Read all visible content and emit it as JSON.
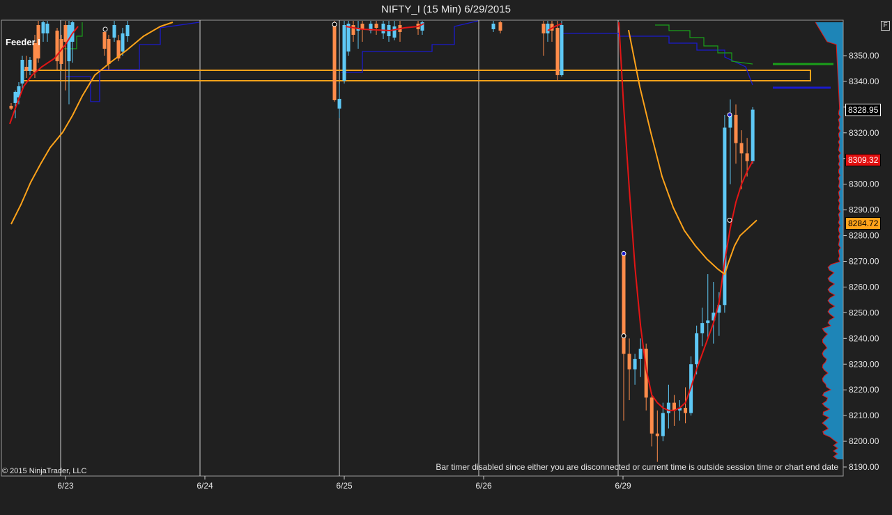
{
  "title": "NIFTY_I (15 Min)  6/29/2015",
  "feeder_label": "Feeder I",
  "copyright": "© 2015 NinjaTrader, LLC",
  "bar_timer_message": "Bar timer disabled since either you are disconnected or current time is outside session time or chart end date",
  "f_button": "F",
  "price_tags": {
    "last": "8328.95",
    "red_ma": "8309.32",
    "orange_ma": "8284.72"
  },
  "colors": {
    "background": "#202020",
    "up_candle": "#5ec8f5",
    "down_candle": "#ff8c4a",
    "fast_ma": "#e31515",
    "slow_ma": "#ffa31a",
    "zone": "#ffa31a",
    "blue_line": "#1a1acc",
    "green_line": "#1aa01a",
    "volume_profile": "#1e90c8",
    "profile_edge": "#e31515"
  },
  "chart_data": {
    "type": "candlestick",
    "title": "NIFTY_I (15 Min)  6/29/2015",
    "y_ticks": [
      8190,
      8200,
      8210,
      8220,
      8230,
      8240,
      8250,
      8260,
      8270,
      8280,
      8290,
      8300,
      8310,
      8320,
      8330,
      8340,
      8350
    ],
    "y_tick_labels": [
      "8190.00",
      "8200.00",
      "8210.00",
      "8220.00",
      "8230.00",
      "8240.00",
      "8250.00",
      "8260.00",
      "8270.00",
      "8280.00",
      "8290.00",
      "8300.00",
      "8310.00",
      "8320.00",
      "8330.00",
      "8340.00",
      "8350.00"
    ],
    "ylim": [
      8185,
      8358
    ],
    "x_labels": [
      "6/23",
      "6/24",
      "6/25",
      "6/26",
      "6/29"
    ],
    "session_boundaries": [
      "6/23",
      "6/24",
      "6/25",
      "6/26",
      "6/29"
    ],
    "resistance_zone": [
      8340.5,
      8342.5
    ],
    "candles_6_29": [
      {
        "o": 8273,
        "h": 8274,
        "l": 8208,
        "c": 8234
      },
      {
        "o": 8234,
        "h": 8240,
        "l": 8216,
        "c": 8228
      },
      {
        "o": 8228,
        "h": 8234,
        "l": 8222,
        "c": 8232
      },
      {
        "o": 8232,
        "h": 8240,
        "l": 8225,
        "c": 8236
      },
      {
        "o": 8236,
        "h": 8238,
        "l": 8212,
        "c": 8217
      },
      {
        "o": 8217,
        "h": 8219,
        "l": 8198,
        "c": 8203
      },
      {
        "o": 8203,
        "h": 8212,
        "l": 8192,
        "c": 8202
      },
      {
        "o": 8202,
        "h": 8215,
        "l": 8200,
        "c": 8211
      },
      {
        "o": 8211,
        "h": 8222,
        "l": 8205,
        "c": 8215
      },
      {
        "o": 8215,
        "h": 8218,
        "l": 8206,
        "c": 8212
      },
      {
        "o": 8212,
        "h": 8216,
        "l": 8208,
        "c": 8213
      },
      {
        "o": 8213,
        "h": 8221,
        "l": 8207,
        "c": 8211
      },
      {
        "o": 8211,
        "h": 8233,
        "l": 8210,
        "c": 8230
      },
      {
        "o": 8230,
        "h": 8245,
        "l": 8226,
        "c": 8242
      },
      {
        "o": 8242,
        "h": 8252,
        "l": 8237,
        "c": 8246
      },
      {
        "o": 8246,
        "h": 8265,
        "l": 8240,
        "c": 8247
      },
      {
        "o": 8247,
        "h": 8262,
        "l": 8238,
        "c": 8250
      },
      {
        "o": 8250,
        "h": 8258,
        "l": 8241,
        "c": 8253
      },
      {
        "o": 8253,
        "h": 8327,
        "l": 8250,
        "c": 8322
      },
      {
        "o": 8322,
        "h": 8333,
        "l": 8300,
        "c": 8327
      },
      {
        "o": 8327,
        "h": 8331,
        "l": 8308,
        "c": 8316
      },
      {
        "o": 8316,
        "h": 8321,
        "l": 8298,
        "c": 8312
      },
      {
        "o": 8312,
        "h": 8318,
        "l": 8303,
        "c": 8309
      },
      {
        "o": 8309,
        "h": 8330,
        "l": 8308,
        "c": 8329
      }
    ],
    "fast_ma_6_29": [
      8330,
      8298,
      8268,
      8245,
      8228,
      8218,
      8215,
      8213,
      8212,
      8212,
      8213,
      8215,
      8221,
      8228,
      8234,
      8240,
      8246,
      8254,
      8270,
      8283,
      8293,
      8300,
      8305,
      8309
    ],
    "slow_ma_6_29": [
      8360,
      8345,
      8330,
      8318,
      8306,
      8296,
      8288,
      8281,
      8276,
      8272,
      8269,
      8267,
      8266,
      8265,
      8270,
      8276,
      8280,
      8284
    ]
  }
}
